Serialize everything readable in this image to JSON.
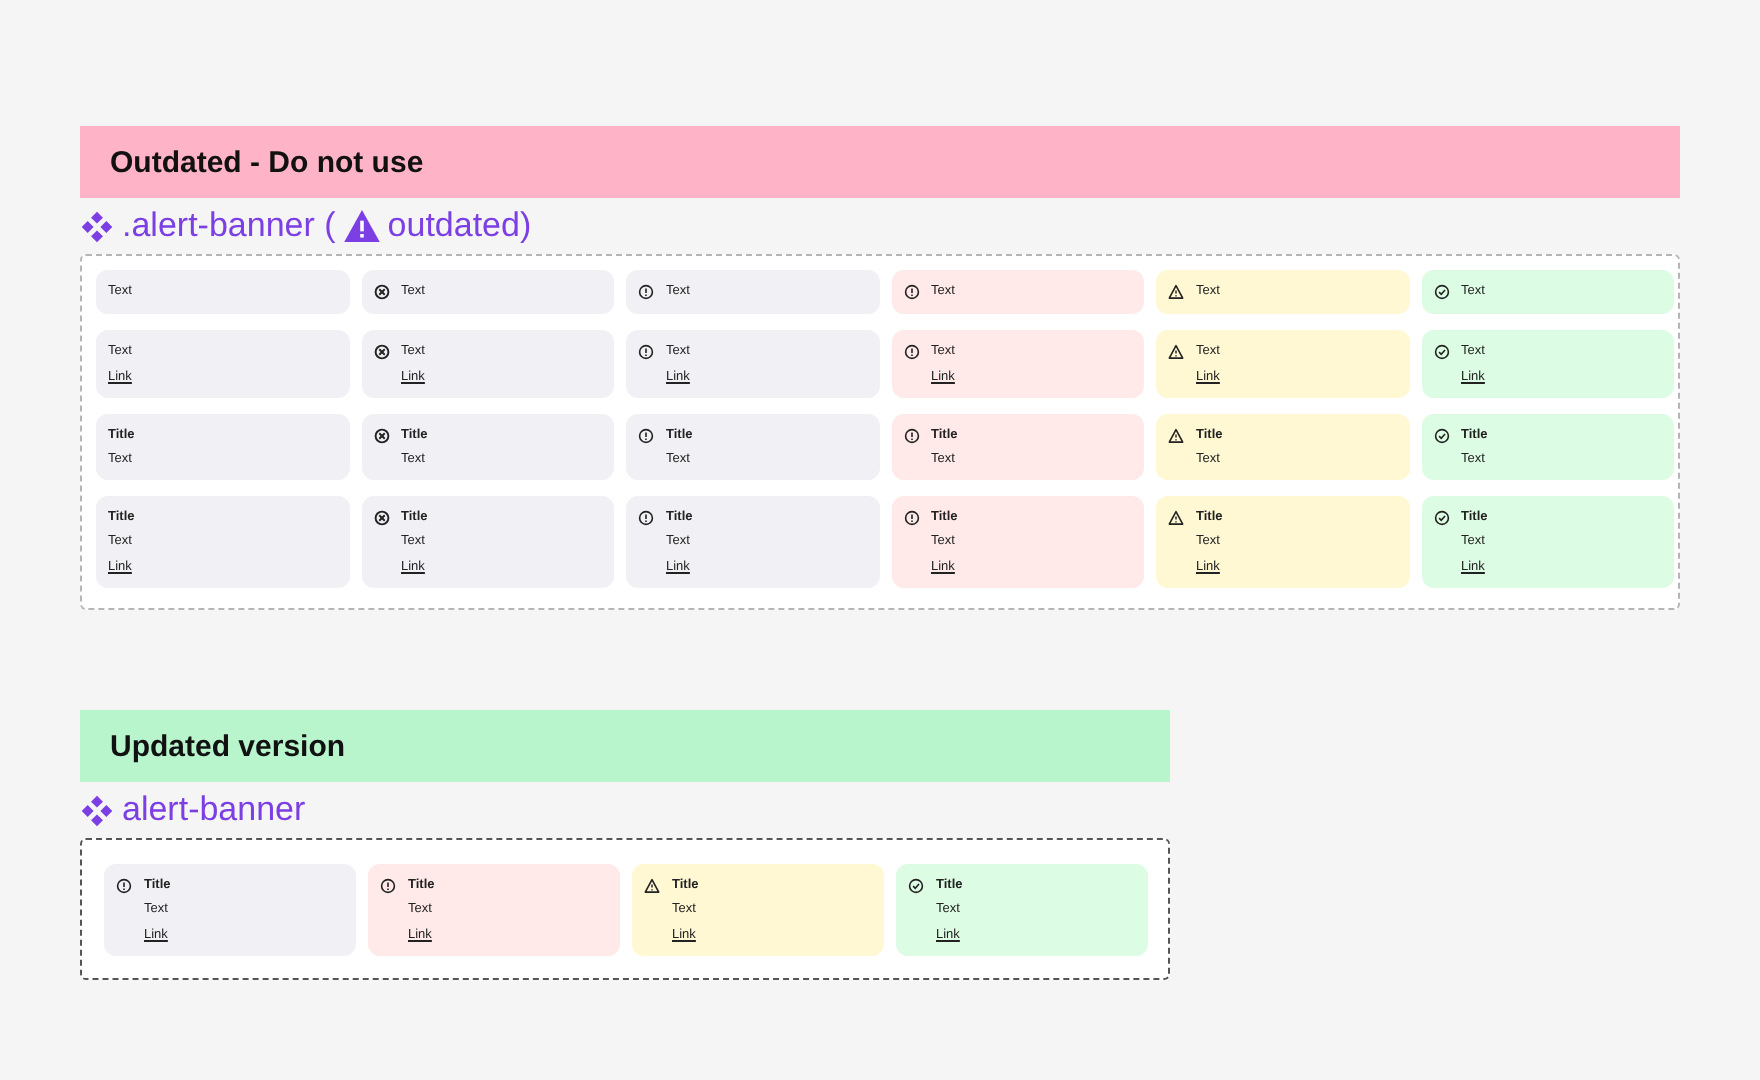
{
  "outdated": {
    "heading": "Outdated - Do not use",
    "component_label": {
      "before_icon": ".alert-banner (",
      "after_icon": "outdated)"
    },
    "rows": [
      {
        "banners": [
          {
            "kind": "plain",
            "text": "Text"
          },
          {
            "kind": "neutral-x",
            "text": "Text"
          },
          {
            "kind": "info",
            "text": "Text"
          },
          {
            "kind": "error",
            "text": "Text"
          },
          {
            "kind": "warning",
            "text": "Text"
          },
          {
            "kind": "success",
            "text": "Text"
          }
        ]
      },
      {
        "banners": [
          {
            "kind": "plain",
            "text": "Text",
            "link": "Link"
          },
          {
            "kind": "neutral-x",
            "text": "Text",
            "link": "Link"
          },
          {
            "kind": "info",
            "text": "Text",
            "link": "Link"
          },
          {
            "kind": "error",
            "text": "Text",
            "link": "Link"
          },
          {
            "kind": "warning",
            "text": "Text",
            "link": "Link"
          },
          {
            "kind": "success",
            "text": "Text",
            "link": "Link"
          }
        ]
      },
      {
        "banners": [
          {
            "kind": "plain",
            "title": "Title",
            "text": "Text"
          },
          {
            "kind": "neutral-x",
            "title": "Title",
            "text": "Text"
          },
          {
            "kind": "info",
            "title": "Title",
            "text": "Text"
          },
          {
            "kind": "error",
            "title": "Title",
            "text": "Text"
          },
          {
            "kind": "warning",
            "title": "Title",
            "text": "Text"
          },
          {
            "kind": "success",
            "title": "Title",
            "text": "Text"
          }
        ]
      },
      {
        "banners": [
          {
            "kind": "plain",
            "title": "Title",
            "text": "Text",
            "link": "Link"
          },
          {
            "kind": "neutral-x",
            "title": "Title",
            "text": "Text",
            "link": "Link"
          },
          {
            "kind": "info",
            "title": "Title",
            "text": "Text",
            "link": "Link"
          },
          {
            "kind": "error",
            "title": "Title",
            "text": "Text",
            "link": "Link"
          },
          {
            "kind": "warning",
            "title": "Title",
            "text": "Text",
            "link": "Link"
          },
          {
            "kind": "success",
            "title": "Title",
            "text": "Text",
            "link": "Link"
          }
        ]
      }
    ]
  },
  "updated": {
    "heading": "Updated version",
    "component_label": {
      "before_icon": "alert-banner"
    },
    "rows": [
      {
        "banners": [
          {
            "kind": "info",
            "title": "Title",
            "text": "Text",
            "link": "Link"
          },
          {
            "kind": "error",
            "title": "Title",
            "text": "Text",
            "link": "Link"
          },
          {
            "kind": "warning",
            "title": "Title",
            "text": "Text",
            "link": "Link"
          },
          {
            "kind": "success",
            "title": "Title",
            "text": "Text",
            "link": "Link"
          }
        ]
      }
    ]
  }
}
